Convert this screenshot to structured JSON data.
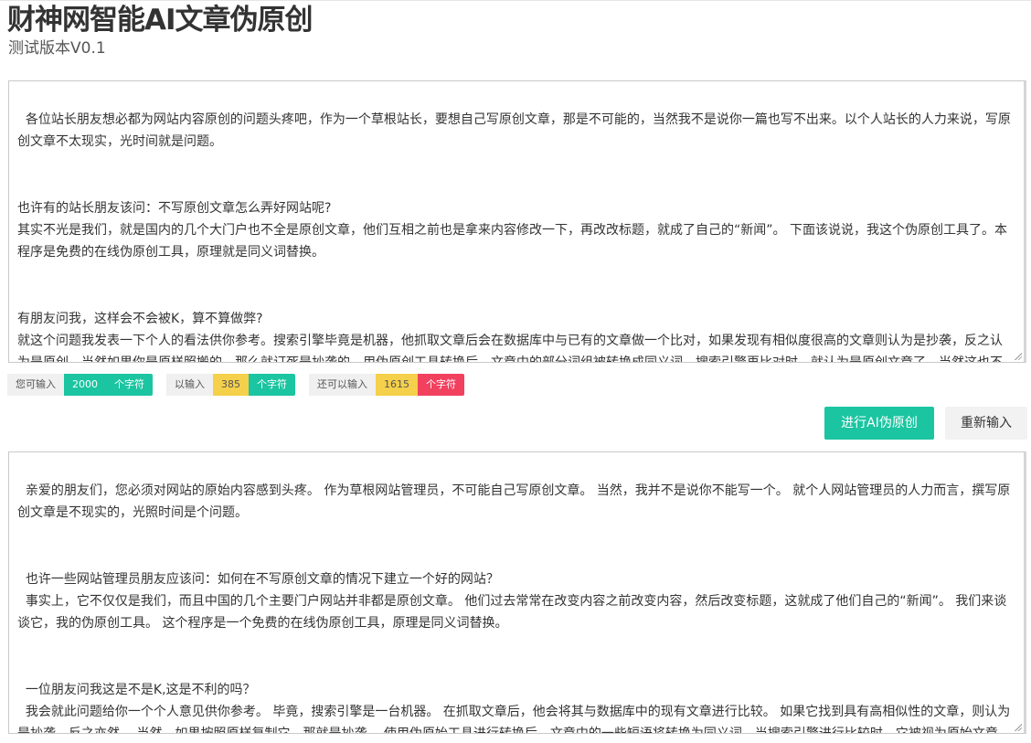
{
  "header": {
    "title": "财神网智能AI文章伪原创",
    "subtitle": "测试版本V0.1"
  },
  "input_area": {
    "text": "各位站长朋友想必都为网站内容原创的问题头疼吧，作为一个草根站长，要想自己写原创文章，那是不可能的，当然我不是说你一篇也写不出来。以个人站长的人力来说，写原创文章不太现实，光时间就是问题。\n\n\n也许有的站长朋友该问：不写原创文章怎么弄好网站呢?\n其实不光是我们，就是国内的几个大门户也不全是原创文章，他们互相之前也是拿来内容修改一下，再改改标题，就成了自己的“新闻”。 下面该说说，我这个伪原创工具了。本程序是免费的在线伪原创工具，原理就是同义词替换。\n\n\n有朋友问我，这样会不会被K，算不算做弊?\n就这个问题我发表一下个人的看法供你参考。搜索引擎毕竟是机器，他抓取文章后会在数据库中与已有的文章做一个比对，如果发现有相似度很高的文章则认为是抄袭，反之认为是原创。当然如果你是原样照搬的，那么就订死是抄袭的。用伪原创工具转换后，文章中的部分词组被转换成同义词，搜索引擎再比对时，就认为是原创文章了。当然这也不是绝对的，看具体转换词组多少而言。"
  },
  "stats": {
    "can_input_label": "您可输入",
    "can_input_value": "2000",
    "can_input_unit": "个字符",
    "entered_label": "以输入",
    "entered_value": "385",
    "entered_unit": "个字符",
    "remaining_label": "还可以输入",
    "remaining_value": "1615",
    "remaining_unit": "个字符"
  },
  "buttons": {
    "rewrite_label": "进行AI伪原创",
    "reset_label": "重新输入"
  },
  "output_area": {
    "text": "亲爱的朋友们，您必须对网站的原始内容感到头疼。 作为草根网站管理员，不可能自己写原创文章。 当然，我并不是说你不能写一个。 就个人网站管理员的人力而言，撰写原创文章是不现实的，光照时间是个问题。\n\n\n  也许一些网站管理员朋友应该问：如何在不写原创文章的情况下建立一个好的网站？\n  事实上，它不仅仅是我们，而且中国的几个主要门户网站并非都是原创文章。 他们过去常常在改变内容之前改变内容，然后改变标题，这就成了他们自己的“新闻”。 我们来谈谈它，我的伪原创工具。 这个程序是一个免费的在线伪原创工具，原理是同义词替换。\n\n\n  一位朋友问我这是不是K,这是不利的吗？\n  我会就此问题给你一个个人意见供你参考。 毕竟，搜索引擎是一台机器。 在抓取文章后，他会将其与数据库中的现有文章进行比较。 如果它找到具有高相似性的文章，则认为是抄袭，反之亦然。 当然，如果按照原样复制它，那就是抄袭。 使用伪原始工具进行转换后，文章中的一些短语将转换为同义词，当搜索引擎进行比较时，它被视为原始文章。 当然，这不是绝对的。 查看特定转换短语的含义。"
  },
  "colors": {
    "accent_green": "#1bc5a1",
    "badge_yellow": "#f5d04a",
    "badge_red": "#f2405f"
  }
}
